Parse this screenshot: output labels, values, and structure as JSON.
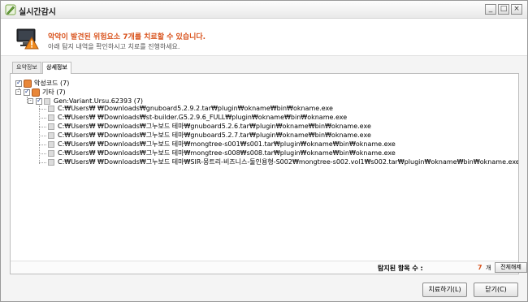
{
  "window": {
    "title": "실시간감시",
    "minimize": "_",
    "maximize": "□",
    "close": "×"
  },
  "header": {
    "title": "악악이 발견된 위험요소 7개를 치료할 수 있습니다.",
    "subtitle": "아래 탐지 내역을 확인하시고 치료를 진행하세요."
  },
  "tabs": [
    {
      "label": "요약정보",
      "active": false
    },
    {
      "label": "상세정보",
      "active": true
    }
  ],
  "tree": {
    "root": {
      "label": "악성코드 (7)"
    },
    "category": {
      "label": "기타 (7)"
    },
    "detection": {
      "label": "Gen:Variant.Ursu.62393 (7)"
    },
    "items": [
      "C:₩Users₩        ₩Downloads₩gnuboard5.2.9.2.tar₩plugin₩okname₩bin₩okname.exe",
      "C:₩Users₩        ₩Downloads₩st-builder.G5.2.9.6_FULL₩plugin₩okname₩bin₩okname.exe",
      "C:₩Users₩        ₩Downloads₩그누보드 테마₩gnuboard5.2.6.tar₩plugin₩okname₩bin₩okname.exe",
      "C:₩Users₩        ₩Downloads₩그누보드 테마₩gnuboard5.2.7.tar₩plugin₩okname₩bin₩okname.exe",
      "C:₩Users₩        ₩Downloads₩그누보드 테마₩mongtree-s001₩s001.tar₩plugin₩okname₩bin₩okname.exe",
      "C:₩Users₩        ₩Downloads₩그누보드 테마₩mongtree-s008₩s008.tar₩plugin₩okname₩bin₩okname.exe",
      "C:₩Users₩        ₩Downloads₩그누보드 테마₩SIR-몽트리-비즈니스-둘인용형-S002₩mongtree-s002.vol1₩s002.tar₩plugin₩okname₩bin₩okname.exe"
    ]
  },
  "summary": {
    "label": "탐지된 항목 수 :",
    "count": "7",
    "unit": "개",
    "release_all": "전체해제"
  },
  "buttons": {
    "treat": "치료하기(L)",
    "close": "닫기(C)"
  },
  "colors": {
    "accent": "#d9541e"
  }
}
